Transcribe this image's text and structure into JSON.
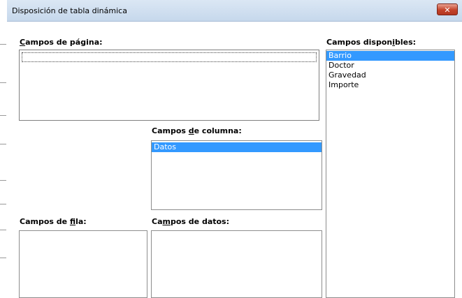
{
  "window": {
    "title": "Disposición de tabla dinámica",
    "close_label": "✕"
  },
  "page_fields": {
    "label_pre": "",
    "label_key": "C",
    "label_post": "ampos de página:",
    "items": []
  },
  "column_fields": {
    "label_pre": "Campos ",
    "label_key": "d",
    "label_post": "e columna:",
    "items": [
      "Datos"
    ],
    "selected_index": 0
  },
  "row_fields": {
    "label_pre": "Campos de ",
    "label_key": "f",
    "label_post": "ila:",
    "items": []
  },
  "data_fields": {
    "label_pre": "Ca",
    "label_key": "m",
    "label_post": "pos de datos:",
    "items": []
  },
  "available_fields": {
    "label_pre": "Campos dispon",
    "label_key": "i",
    "label_post": "bles:",
    "items": [
      "Barrio",
      "Doctor",
      "Gravedad",
      "Importe"
    ],
    "selected_index": 0
  },
  "colors": {
    "selection": "#3399ff",
    "close_button": "#c4432b",
    "titlebar": "#dbe7f4"
  }
}
